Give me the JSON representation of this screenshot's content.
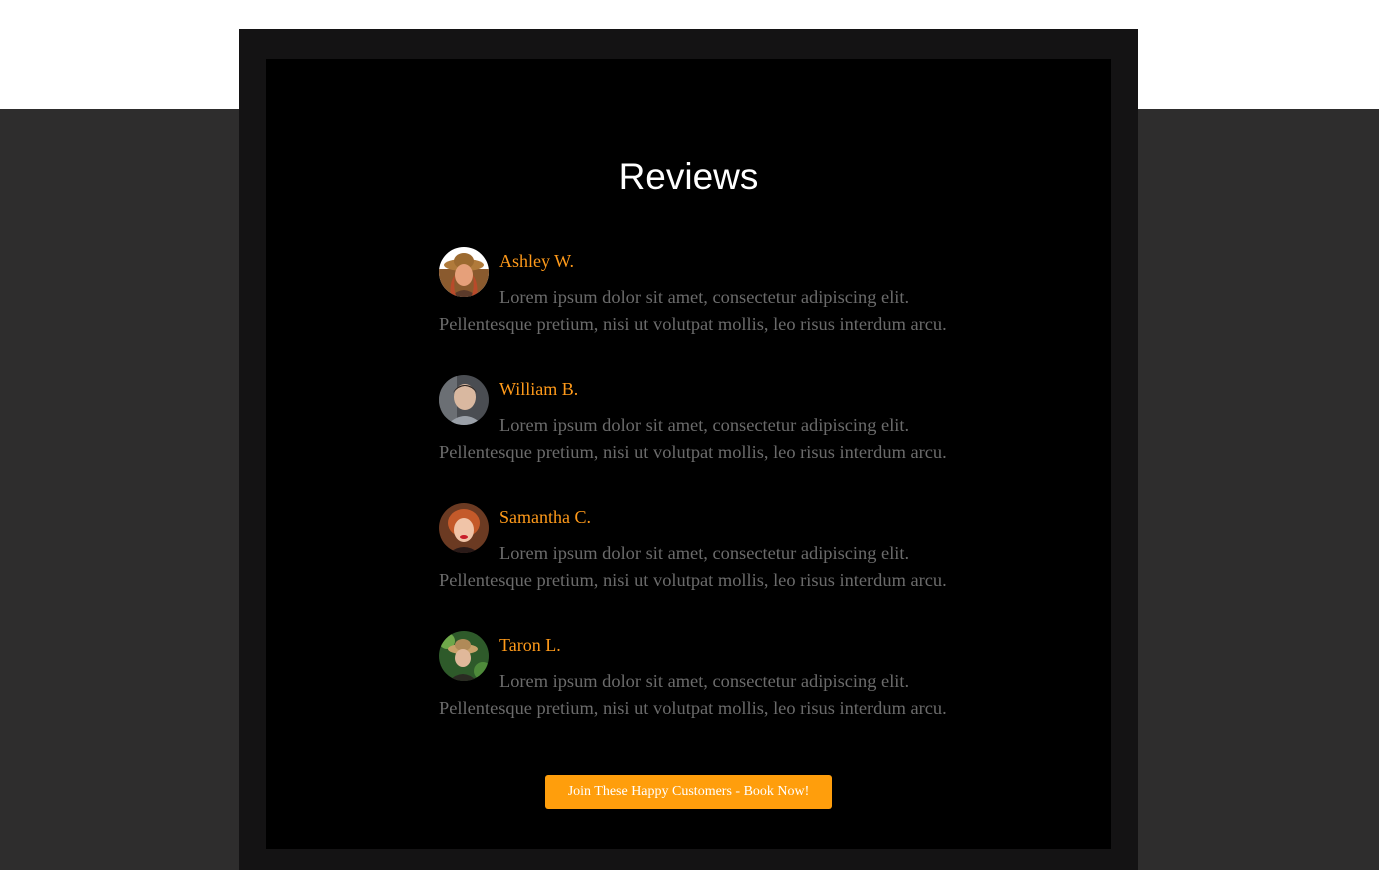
{
  "section": {
    "title": "Reviews"
  },
  "reviews": [
    {
      "name": "Ashley W.",
      "text": "Lorem ipsum dolor sit amet, consectetur adipiscing elit. Pellentesque pretium, nisi ut volutpat mollis, leo risus interdum arcu."
    },
    {
      "name": "William B.",
      "text": "Lorem ipsum dolor sit amet, consectetur adipiscing elit. Pellentesque pretium, nisi ut volutpat mollis, leo risus interdum arcu."
    },
    {
      "name": "Samantha C.",
      "text": "Lorem ipsum dolor sit amet, consectetur adipiscing elit. Pellentesque pretium, nisi ut volutpat mollis, leo risus interdum arcu."
    },
    {
      "name": "Taron L.",
      "text": "Lorem ipsum dolor sit amet, consectetur adipiscing elit. Pellentesque pretium, nisi ut volutpat mollis, leo risus interdum arcu."
    }
  ],
  "cta": {
    "label": "Join These Happy Customers - Book Now!"
  },
  "colors": {
    "accent": "#ff9a1a",
    "button": "#ff9e0c",
    "panel": "#000000",
    "frame": "#141314",
    "page_bg": "#2e2d2d",
    "muted_text": "#6b6b6b"
  }
}
